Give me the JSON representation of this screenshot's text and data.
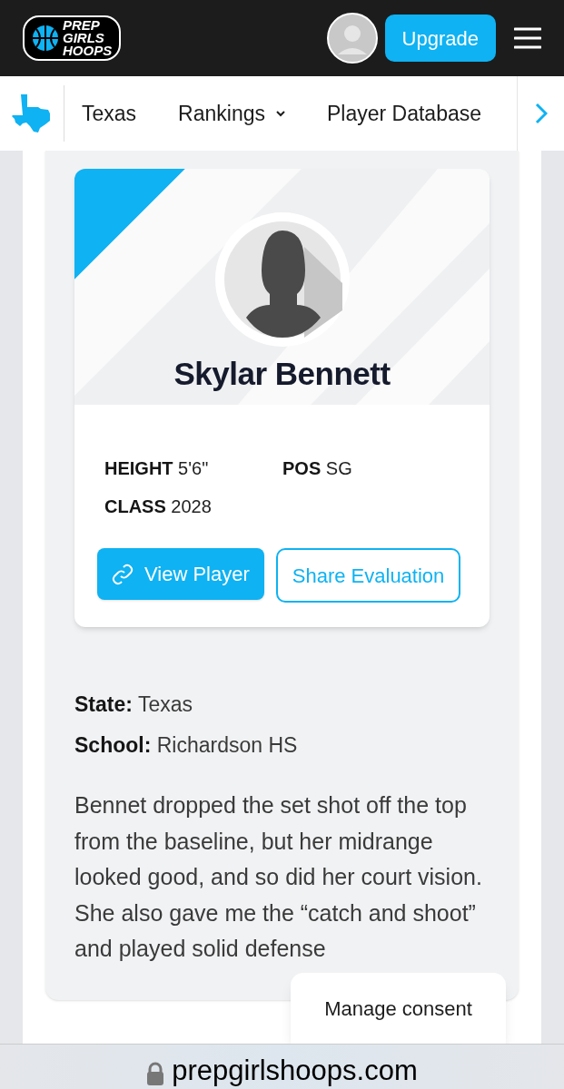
{
  "header": {
    "logo_lines": [
      "PREP",
      "GIRLS",
      "HOOPS"
    ],
    "upgrade_button": "Upgrade"
  },
  "nav": {
    "items": [
      {
        "label": "Texas",
        "dropdown": false
      },
      {
        "label": "Rankings",
        "dropdown": true
      },
      {
        "label": "Player Database",
        "dropdown": false
      }
    ]
  },
  "player_card": {
    "name": "Skylar Bennett",
    "stats": [
      {
        "label": "HEIGHT",
        "value": "5'6\""
      },
      {
        "label": "POS",
        "value": "SG"
      },
      {
        "label": "CLASS",
        "value": "2028"
      }
    ],
    "buttons": [
      {
        "label": "View Player",
        "kind": "primary"
      },
      {
        "label": "Share Evaluation",
        "kind": "outline"
      }
    ]
  },
  "details": [
    {
      "label": "State:",
      "value": "Texas"
    },
    {
      "label": "School:",
      "value": "Richardson HS"
    }
  ],
  "evaluation": "Bennet dropped the set shot off the top from the baseline, but her midrange looked good, and so did her court vision. She also gave me the “catch and shoot” and played solid defense",
  "consent_button": "Manage consent",
  "browser": {
    "url": "prepgirlshoops.com"
  }
}
